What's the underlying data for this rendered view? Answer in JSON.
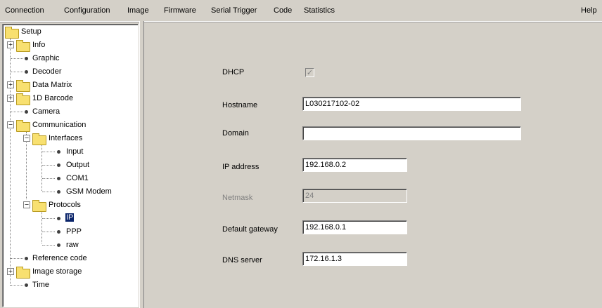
{
  "menu": {
    "connection": "Connection",
    "configuration": "Configuration",
    "image": "Image",
    "firmware": "Firmware",
    "serial_trigger": "Serial Trigger",
    "code": "Code",
    "statistics": "Statistics",
    "help": "Help"
  },
  "tree": {
    "setup": "Setup",
    "info": "Info",
    "graphic": "Graphic",
    "decoder": "Decoder",
    "data_matrix": "Data Matrix",
    "barcode_1d": "1D Barcode",
    "camera": "Camera",
    "communication": "Communication",
    "interfaces": "Interfaces",
    "input": "Input",
    "output": "Output",
    "com1": "COM1",
    "gsm_modem": "GSM Modem",
    "protocols": "Protocols",
    "ip": "IP",
    "ppp": "PPP",
    "raw": "raw",
    "reference_code": "Reference code",
    "image_storage": "Image storage",
    "time": "Time",
    "expander_plus": "+",
    "expander_minus": "−"
  },
  "form": {
    "dhcp_label": "DHCP",
    "dhcp_checked": "✓",
    "hostname_label": "Hostname",
    "hostname_value": "L030217102-02",
    "domain_label": "Domain",
    "domain_value": "",
    "ip_label": "IP address",
    "ip_value": "192.168.0.2",
    "netmask_label": "Netmask",
    "netmask_value": "24",
    "gateway_label": "Default gateway",
    "gateway_value": "192.168.0.1",
    "dns_label": "DNS server",
    "dns_value": "172.16.1.3"
  }
}
